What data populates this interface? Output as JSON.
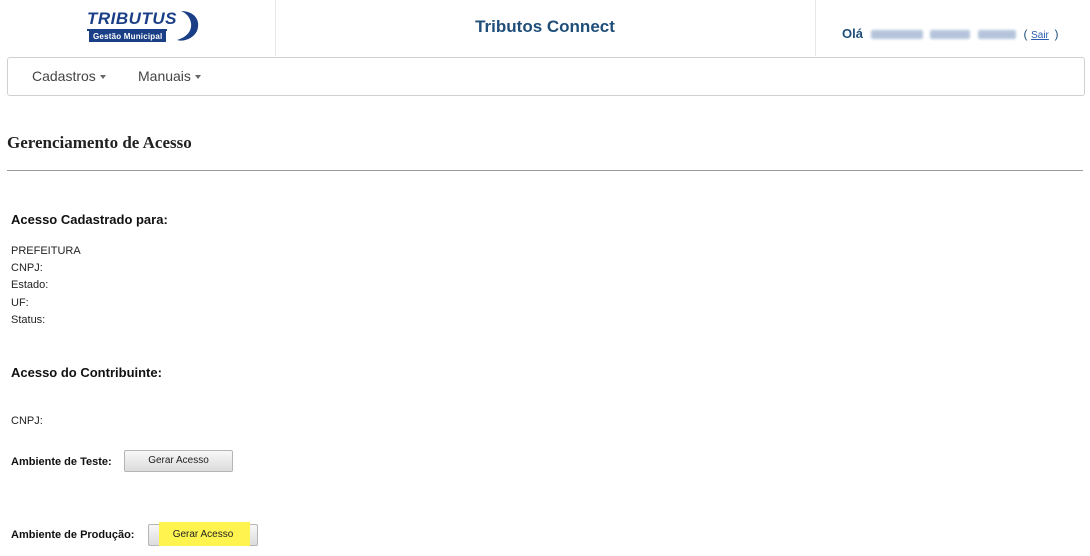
{
  "header": {
    "logo_text": "TRIBUTUS",
    "logo_sub": "Gestão Municipal",
    "app_title": "Tributos Connect",
    "greeting": "Olá",
    "logout_open": "(",
    "logout_label": "Sair",
    "logout_close": ")"
  },
  "nav": {
    "items": [
      {
        "label": "Cadastros"
      },
      {
        "label": "Manuais"
      }
    ]
  },
  "page": {
    "title": "Gerenciamento de Acesso"
  },
  "registered": {
    "heading": "Acesso Cadastrado para:",
    "fields": [
      "PREFEITURA",
      "CNPJ:",
      "Estado:",
      "UF:",
      "Status:"
    ]
  },
  "taxpayer": {
    "heading": "Acesso do Contribuinte:",
    "cnpj_label": "CNPJ:",
    "test_env_label": "Ambiente de Teste:",
    "test_button": "Gerar Acesso",
    "prod_env_label": "Ambiente de Produção:",
    "prod_button": "Gerar Acesso"
  },
  "colors": {
    "brand_blue": "#1b3f86",
    "title_blue": "#1f4e79",
    "highlight": "#fff44f"
  }
}
